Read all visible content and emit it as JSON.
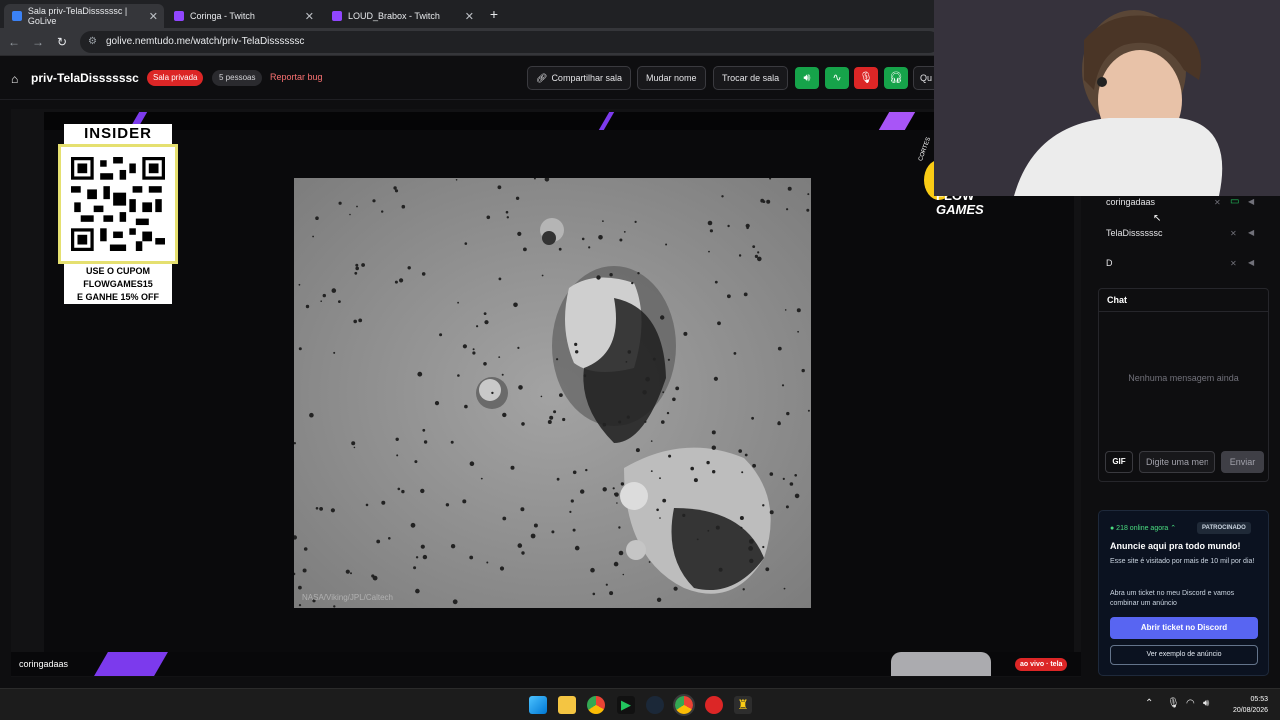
{
  "browser": {
    "tabs": [
      {
        "title": "Sala priv-TelaDissssssc | GoLive",
        "active": true,
        "favicon_color": "#3b82f6"
      },
      {
        "title": "Coringa - Twitch",
        "active": false,
        "favicon_color": "#9146ff"
      },
      {
        "title": "LOUD_Brabox - Twitch",
        "active": false,
        "favicon_color": "#9146ff"
      }
    ],
    "url": "golive.nemtudo.me/watch/priv-TelaDissssssc"
  },
  "header": {
    "room_title": "priv-TelaDissssssc",
    "private_badge": "Sala privada",
    "people_badge": "5 pessoas",
    "report_bug": "Reportar bug",
    "share_button": "Compartilhar sala",
    "rename_button": "Mudar nome",
    "switch_room_button": "Trocar de sala",
    "truncated_button": "Qu"
  },
  "stream": {
    "promo": {
      "brand": "INSIDER",
      "coupon_line1": "USE O CUPOM",
      "coupon_line2": "FLOWGAMES15",
      "coupon_line3": "E GANHE 15% OFF"
    },
    "logo_text_1": "CORTES",
    "logo_text_2": "FLOW",
    "logo_text_3": "GAMES",
    "image_credit": "NASA/Viking/JPL/Caltech",
    "streamer_name": "coringadaas",
    "live_badge": "ao vivo · tela"
  },
  "members": [
    {
      "name": "coringadaas",
      "screen_sharing": true
    },
    {
      "name": "TelaDissssssc",
      "screen_sharing": false
    },
    {
      "name": "D",
      "screen_sharing": false
    }
  ],
  "chat": {
    "title": "Chat",
    "empty_text": "Nenhuma mensagem ainda",
    "gif_label": "GIF",
    "input_placeholder": "Digite uma mensagem",
    "send_label": "Enviar"
  },
  "ad": {
    "online": "● 218 online agora ⌃",
    "sponsored": "PATROCINADO",
    "title": "Anuncie aqui pra todo mundo!",
    "text1": "Esse site é visitado por mais de 10 mil por dia!",
    "text2": "Abra um ticket no meu Discord e vamos combinar um anúncio",
    "discord_button": "Abrir ticket no Discord",
    "example_button": "Ver exemplo de anúncio"
  },
  "taskbar": {
    "time": "05:53",
    "date": "20/08/2026"
  },
  "colors": {
    "accent_red": "#dc2626",
    "green": "#16a34a",
    "discord": "#5865f2"
  }
}
